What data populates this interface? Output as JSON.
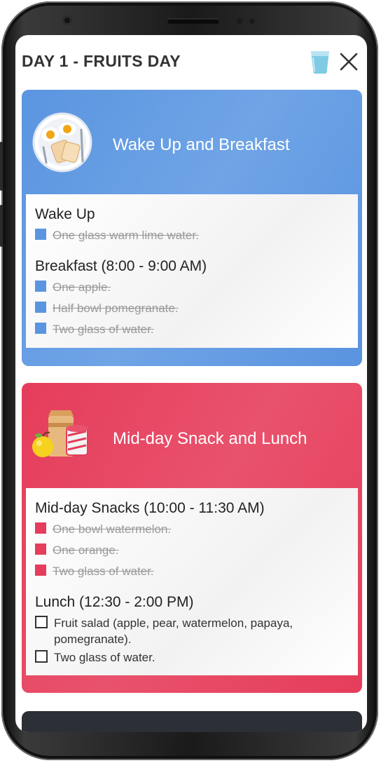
{
  "header": {
    "title": "DAY 1 - FRUITS DAY",
    "water_icon": "water-glass-icon",
    "close_icon": "close-icon"
  },
  "colors": {
    "breakfast_accent": "#5b95e0",
    "lunch_accent": "#e53d5b",
    "dark_card": "#2d2f36"
  },
  "cards": [
    {
      "title": "Wake Up and Breakfast",
      "icon": "breakfast-plate-icon",
      "sections": [
        {
          "title": "Wake Up",
          "items": [
            {
              "text": "One glass warm lime water.",
              "checked": true
            }
          ]
        },
        {
          "title": "Breakfast (8:00 - 9:00 AM)",
          "items": [
            {
              "text": "One apple.",
              "checked": true
            },
            {
              "text": "Half bowl pomegranate.",
              "checked": true
            },
            {
              "text": "Two glass of water.",
              "checked": true
            }
          ]
        }
      ]
    },
    {
      "title": "Mid-day Snack and Lunch",
      "icon": "lunch-bag-apple-icon",
      "sections": [
        {
          "title": "Mid-day Snacks (10:00 - 11:30 AM)",
          "items": [
            {
              "text": "One bowl watermelon.",
              "checked": true
            },
            {
              "text": "One orange.",
              "checked": true
            },
            {
              "text": "Two glass of water.",
              "checked": true
            }
          ]
        },
        {
          "title": "Lunch (12:30 - 2:00 PM)",
          "items": [
            {
              "text": "Fruit salad (apple, pear, watermelon, papaya, pomegranate).",
              "checked": false
            },
            {
              "text": "Two glass of water.",
              "checked": false
            }
          ]
        }
      ]
    }
  ]
}
